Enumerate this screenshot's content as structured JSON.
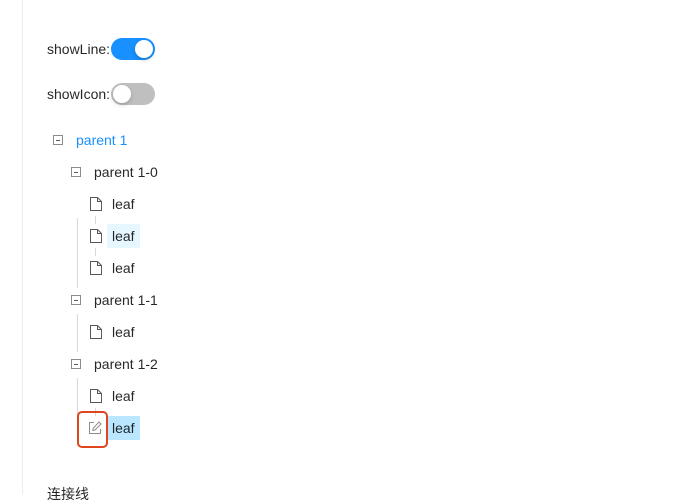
{
  "controls": {
    "show_line": {
      "label": "showLine:",
      "state": "on"
    },
    "show_icon": {
      "label": "showIcon:",
      "state": "off"
    }
  },
  "tree": {
    "root": {
      "label": "parent 1",
      "expanded": true
    },
    "children": [
      {
        "label": "parent 1-0",
        "expanded": true,
        "leaves": [
          "leaf",
          "leaf",
          "leaf"
        ]
      },
      {
        "label": "parent 1-1",
        "expanded": true,
        "leaves": [
          "leaf"
        ]
      },
      {
        "label": "parent 1-2",
        "expanded": true,
        "leaves": [
          "leaf",
          "leaf"
        ]
      }
    ]
  },
  "footer": {
    "cut_text": "连接线"
  },
  "colors": {
    "primary": "#1890ff",
    "switch_off": "#bfbfbf",
    "highlight": "#e6f7ff",
    "selected": "#bae7ff",
    "annotation": "#e0461e"
  }
}
